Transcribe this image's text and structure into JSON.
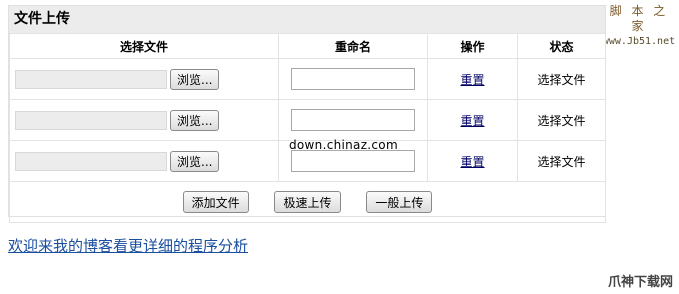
{
  "watermark_top": {
    "name": "脚 本 之 家",
    "url": "www.Jb51.net"
  },
  "panel": {
    "title": "文件上传"
  },
  "table": {
    "headers": [
      "选择文件",
      "重命名",
      "操作",
      "状态"
    ],
    "rows": [
      {
        "browse_label": "浏览...",
        "rename_value": "",
        "action_label": "重置",
        "status": "选择文件"
      },
      {
        "browse_label": "浏览...",
        "rename_value": "",
        "action_label": "重置",
        "status": "选择文件"
      },
      {
        "browse_label": "浏览...",
        "rename_value": "",
        "action_label": "重置",
        "status": "选择文件"
      }
    ]
  },
  "buttons": {
    "add_file": "添加文件",
    "fast_upload": "极速上传",
    "normal_upload": "一般上传"
  },
  "overlay_domain": "down.chinaz.com",
  "blog_link": "欢迎来我的博客看更详细的程序分析",
  "watermark_bottom": "爪神下载网"
}
